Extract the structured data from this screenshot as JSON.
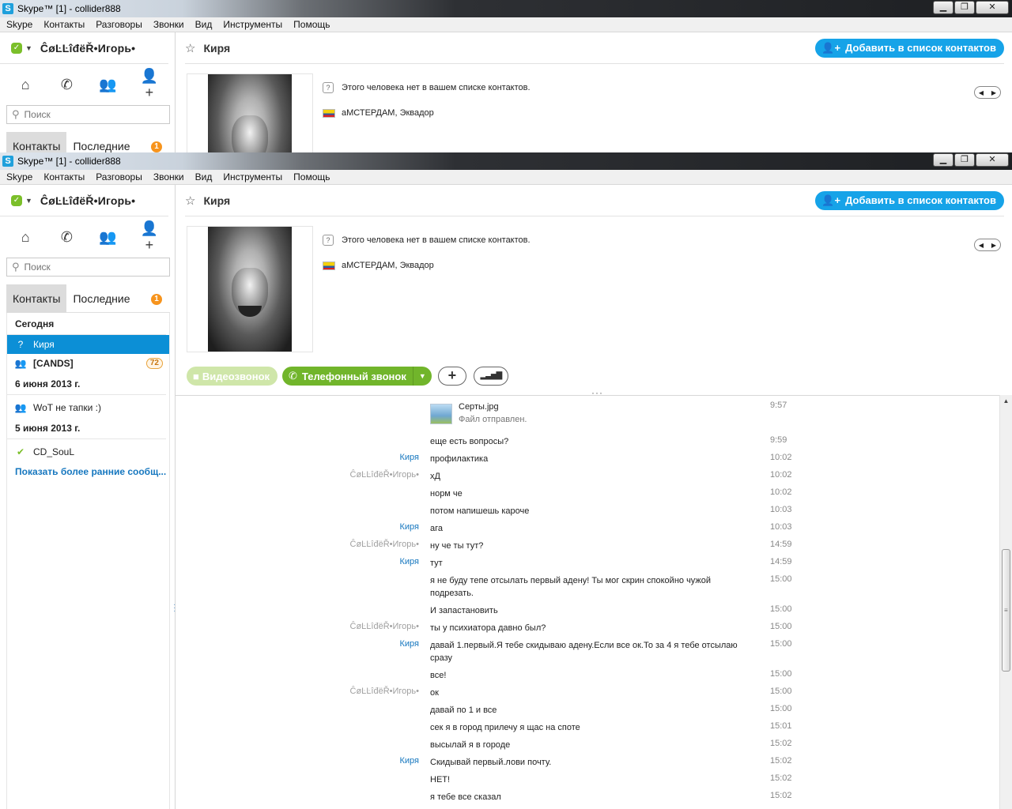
{
  "window": {
    "title": "Skype™ [1] - collider888",
    "app_icon": "S",
    "ctrl_min": "▁",
    "ctrl_max": "❐",
    "ctrl_close": "✕"
  },
  "menu": [
    "Skype",
    "Контакты",
    "Разговоры",
    "Звонки",
    "Вид",
    "Инструменты",
    "Помощь"
  ],
  "profile": {
    "name": "ĈøĿĿîđëŘ•Игорь•",
    "status": "online"
  },
  "search": {
    "placeholder": "Поиск"
  },
  "tabs": {
    "contacts": "Контакты",
    "recent": "Последние",
    "recent_badge": "1"
  },
  "recent": {
    "today": "Сегодня",
    "items": [
      {
        "name": "Киря",
        "icon": "skype-status-icon"
      },
      {
        "name": "[CANDS]",
        "icon": "group-icon",
        "badge": "72"
      }
    ],
    "date1": "6 июня 2013 г.",
    "item_wot": "WoT не тапки :)",
    "date2": "5 июня 2013 г.",
    "item_cd": "CD_SouL",
    "more_link": "Показать более ранние сообщ..."
  },
  "contact": {
    "name": "Киря",
    "add_button": "Добавить в список контактов",
    "not_in_list": "Этого человека нет в вашем списке контактов.",
    "location": "аМСТЕРДАМ, Эквадор"
  },
  "calls": {
    "video": "Видеозвонок",
    "phone": "Телефонный звонок"
  },
  "file": {
    "name": "Серты.jpg",
    "status": "Файл отправлен.",
    "time": "9:57"
  },
  "messages": [
    {
      "sender": "",
      "text": "еще есть вопросы?",
      "time": "9:59"
    },
    {
      "sender": "Киря",
      "text": "профилактика",
      "time": "10:02"
    },
    {
      "sender": "ĈøĿĿîđëŘ•Игорь•",
      "text": "хД",
      "time": "10:02"
    },
    {
      "sender": "",
      "text": "норм че",
      "time": "10:02"
    },
    {
      "sender": "",
      "text": "потом напишешь кароче",
      "time": "10:03"
    },
    {
      "sender": "Киря",
      "text": "ага",
      "time": "10:03"
    },
    {
      "sender": "ĈøĿĿîđëŘ•Игорь•",
      "text": "ну че ты тут?",
      "time": "14:59"
    },
    {
      "sender": "Киря",
      "text": "тут",
      "time": "14:59"
    },
    {
      "sender": "",
      "text": "я не буду тепе отсылать первый адену! Ты мог скрин спокойно чужой подрезать.",
      "time": "15:00"
    },
    {
      "sender": "",
      "text": "И запастановить",
      "time": "15:00"
    },
    {
      "sender": "ĈøĿĿîđëŘ•Игорь•",
      "text": "ты у психиатора давно был?",
      "time": "15:00"
    },
    {
      "sender": "Киря",
      "text": "давай 1.первый.Я тебе скидываю адену.Если все ок.То за 4 я тебе отсылаю сразу",
      "time": "15:00"
    },
    {
      "sender": "",
      "text": "все!",
      "time": "15:00"
    },
    {
      "sender": "ĈøĿĿîđëŘ•Игорь•",
      "text": "ок",
      "time": "15:00"
    },
    {
      "sender": "",
      "text": "давай по 1 и все",
      "time": "15:00"
    },
    {
      "sender": "",
      "text": "сек я в город прилечу я щас на споте",
      "time": "15:01"
    },
    {
      "sender": "",
      "text": "высылай я в городе",
      "time": "15:02"
    },
    {
      "sender": "Киря",
      "text": "Скидывай первый.лови почту.",
      "time": "15:02"
    },
    {
      "sender": "",
      "text": "НЕТ!",
      "time": "15:02"
    },
    {
      "sender": "",
      "text": "я тебе все сказал",
      "time": "15:02"
    }
  ],
  "colors": {
    "accent_blue": "#16a3e8",
    "call_green": "#71b52b",
    "selection": "#0c8fd6",
    "badge_orange": "#f7941d"
  }
}
